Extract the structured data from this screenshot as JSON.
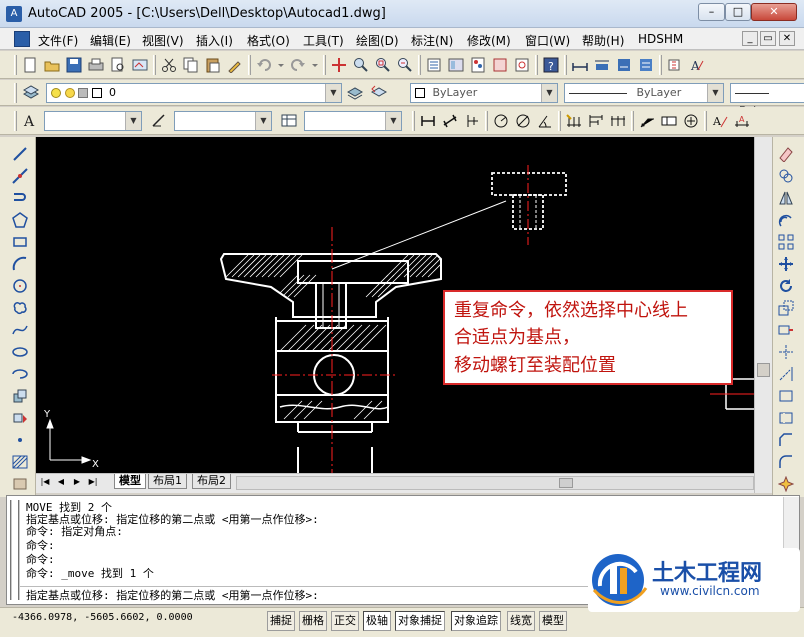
{
  "window": {
    "app_icon": "autocad-app-icon",
    "title": "AutoCAD 2005 - [C:\\Users\\Dell\\Desktop\\Autocad1.dwg]",
    "minimize": "–",
    "maximize": "□",
    "close": "✕"
  },
  "menu": {
    "items": [
      "文件(F)",
      "编辑(E)",
      "视图(V)",
      "插入(I)",
      "格式(O)",
      "工具(T)",
      "绘图(D)",
      "标注(N)",
      "修改(M)",
      "窗口(W)",
      "帮助(H)",
      "HDSHM"
    ],
    "mdi_min": "_",
    "mdi_restore": "▭",
    "mdi_close": "✕"
  },
  "layers": {
    "current_layer": "0",
    "color_value": "ByLayer",
    "linetype_value": "ByLayer",
    "lineweight_value": "ByLay"
  },
  "canvas": {
    "ucs_y": "Y",
    "ucs_x": "X"
  },
  "tabs": {
    "model": "模型",
    "layout1": "布局1",
    "layout2": "布局2"
  },
  "command": {
    "lines": [
      "MOVE 找到 2 个",
      "指定基点或位移: 指定位移的第二点或 <用第一点作位移>:",
      "命令: 指定对角点:",
      "命令:",
      "命令:",
      "命令: _move 找到 1 个",
      "指定基点或位移: 指定位移的第二点或 <用第一点作位移>:"
    ]
  },
  "status": {
    "coords": "-4366.0978, -5605.6602, 0.0000",
    "buttons": [
      "捕捉",
      "栅格",
      "正交",
      "极轴",
      "对象捕捉",
      "对象追踪",
      "线宽",
      "模型"
    ]
  },
  "annotation": {
    "line1": "重复命令，依然选择中心线上",
    "line2": "合适点为基点，",
    "line3": "移动螺钉至装配位置"
  },
  "watermark": {
    "brand": "土木工程网",
    "url": "www.civilcn.com"
  },
  "colors": {
    "annotation_red": "#c0140e",
    "canvas_bg": "#000000",
    "drawing_white": "#ffffff",
    "centerline_red": "#ff2020"
  }
}
